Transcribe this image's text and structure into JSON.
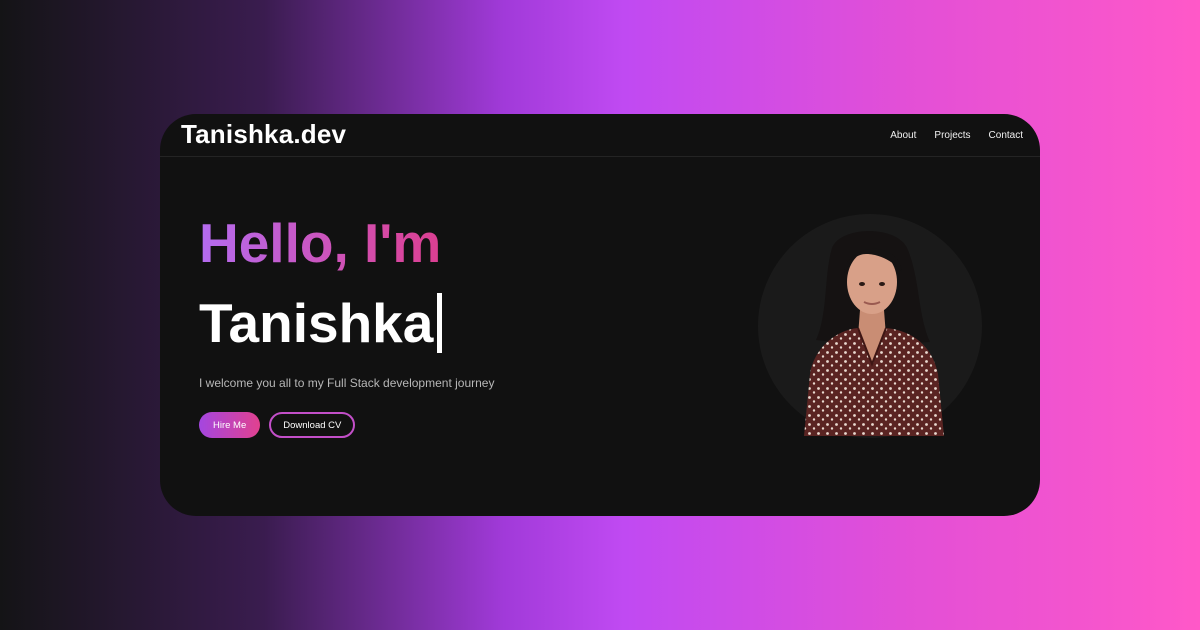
{
  "nav": {
    "logo": "Tanishka.dev",
    "links": [
      "About",
      "Projects",
      "Contact"
    ]
  },
  "hero": {
    "greeting": "Hello, I'm",
    "name": "Tanishka",
    "tagline": "I welcome you all to my Full Stack development journey",
    "buttons": {
      "primary": "Hire Me",
      "secondary": "Download CV"
    }
  },
  "colors": {
    "card_background": "#111111",
    "accent_start": "#a446e0",
    "accent_end": "#e1418f",
    "outline_border": "#c34fc9"
  },
  "icons": {
    "cursor": "text-cursor-bar"
  }
}
